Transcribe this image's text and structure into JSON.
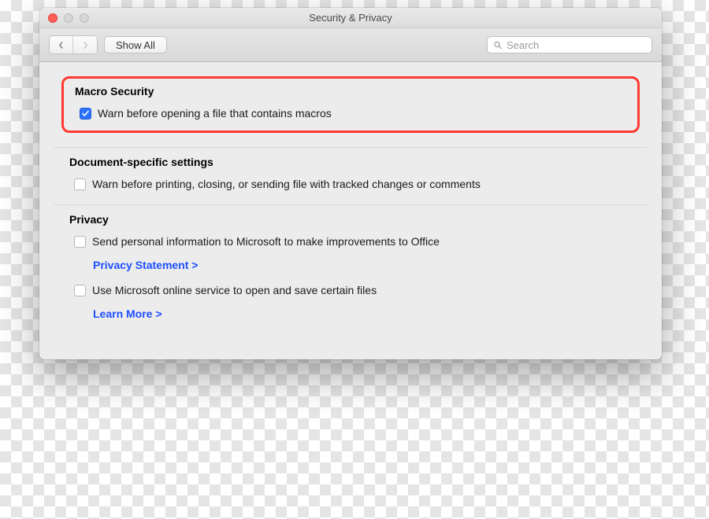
{
  "window": {
    "title": "Security & Privacy"
  },
  "toolbar": {
    "show_all_label": "Show All",
    "search_placeholder": "Search"
  },
  "sections": {
    "macro": {
      "title": "Macro Security",
      "warn_macros": {
        "label": "Warn before opening a file that contains macros",
        "checked": true
      }
    },
    "document": {
      "title": "Document-specific settings",
      "warn_tracked": {
        "label": "Warn before printing, closing, or sending file with tracked changes or comments",
        "checked": false
      }
    },
    "privacy": {
      "title": "Privacy",
      "send_info": {
        "label": "Send personal information to Microsoft to make improvements to Office",
        "checked": false
      },
      "privacy_statement_link": "Privacy Statement >",
      "use_online": {
        "label": "Use Microsoft online service to open and save certain files",
        "checked": false
      },
      "learn_more_link": "Learn More >"
    }
  }
}
